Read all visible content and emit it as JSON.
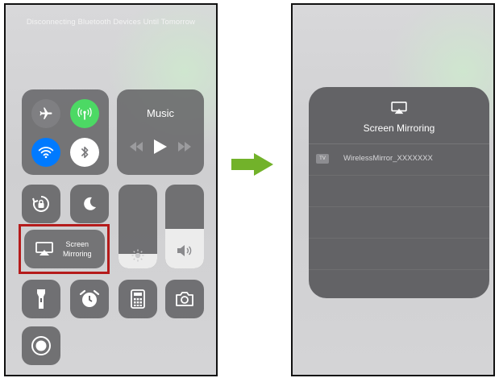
{
  "left_screen": {
    "banner": "Disconnecting Bluetooth Devices Until Tomorrow",
    "music": {
      "title": "Music"
    },
    "screen_mirroring": {
      "line1": "Screen",
      "line2": "Mirroring"
    },
    "brightness_level": 0.17,
    "volume_level": 0.47
  },
  "right_screen": {
    "title": "Screen Mirroring",
    "devices": [
      {
        "badge": "TV",
        "name": "WirelessMirror_XXXXXXX"
      }
    ]
  },
  "colors": {
    "cellular": "#4cd964",
    "wifi": "#007aff",
    "highlight": "#b51b1b",
    "arrow": "#72b22a"
  },
  "icons": [
    "airplane-icon",
    "cellular-icon",
    "wifi-icon",
    "bluetooth-icon",
    "rotation-lock-icon",
    "moon-icon",
    "airplay-icon",
    "flashlight-icon",
    "alarm-icon",
    "calculator-icon",
    "camera-icon",
    "record-icon",
    "arrow-right-icon"
  ]
}
